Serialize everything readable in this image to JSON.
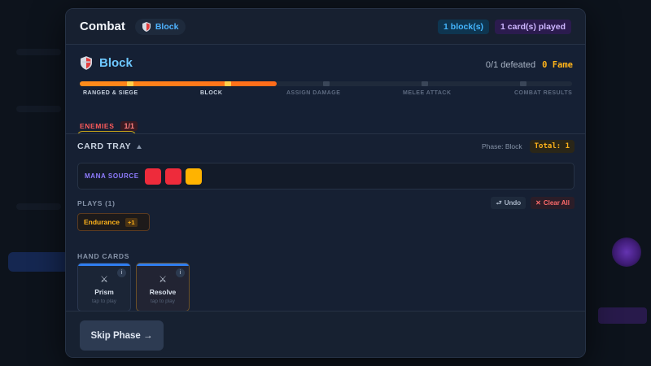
{
  "colors": {
    "accent_blue": "#44b6ff",
    "accent_orange": "#ff8c1a",
    "fame_yellow": "#ffb31a",
    "enemy_red": "#ff5b5b",
    "mana_purple": "#8f7cff"
  },
  "header": {
    "title": "Combat",
    "phase_pill": "Block",
    "blocks_badge": "1 block(s)",
    "cards_badge": "1 card(s) played"
  },
  "phase": {
    "name": "Block",
    "icon": "shield-icon",
    "defeated": "0/1 defeated",
    "fame": "0 Fame",
    "progress_fraction": 0.4,
    "steps": [
      {
        "label": "RANGED & SIEGE",
        "done": true
      },
      {
        "label": "BLOCK",
        "done": true
      },
      {
        "label": "ASSIGN DAMAGE",
        "done": false
      },
      {
        "label": "MELEE ATTACK",
        "done": false
      },
      {
        "label": "COMBAT RESULTS",
        "done": false
      }
    ]
  },
  "enemies": {
    "label": "ENEMIES",
    "count": "1/1"
  },
  "tray": {
    "title": "CARD TRAY",
    "phase_text": "Phase: Block",
    "total": "Total: 1",
    "mana_label": "MANA SOURCE",
    "mana_dice": [
      "#ee2b3b",
      "#ee2b3b",
      "#ffb300"
    ],
    "plays_label": "PLAYS (1)",
    "undo_label": "Undo",
    "clear_label": "Clear All",
    "plays": [
      {
        "name": "Endurance",
        "value": "+1"
      }
    ],
    "hand_label": "HAND CARDS",
    "hand": [
      {
        "name": "Prism",
        "hint": "tap to play",
        "icon": "crossed-swords-icon"
      },
      {
        "name": "Resolve",
        "hint": "tap to play",
        "icon": "crossed-swords-icon"
      }
    ]
  },
  "footer": {
    "skip_label": "Skip Phase →"
  }
}
